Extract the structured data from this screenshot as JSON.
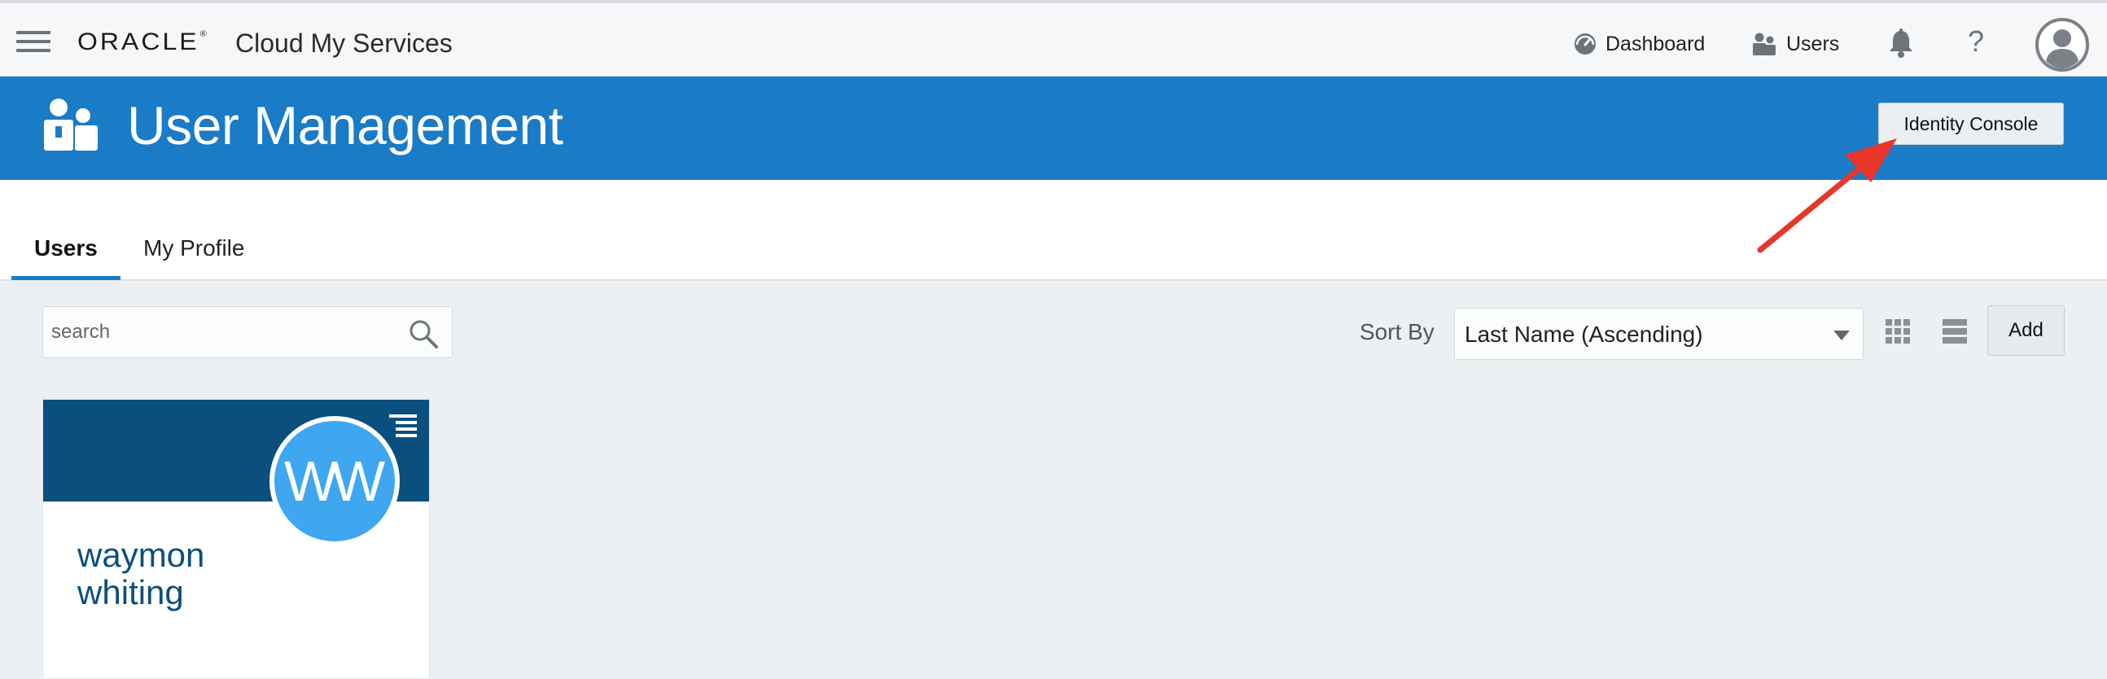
{
  "topbar": {
    "brand": "ORACLE",
    "brand_mark": "®",
    "app_name": "Cloud My Services",
    "nav": {
      "dashboard_label": "Dashboard",
      "users_label": "Users",
      "help_glyph": "?"
    },
    "icons": {
      "menu": "hamburger-menu-icon",
      "dashboard": "dashboard-gauge-icon",
      "users": "users-icon",
      "notifications": "bell-icon",
      "help": "help-icon",
      "profile": "user-avatar-icon"
    }
  },
  "banner": {
    "title": "User Management",
    "identity_console_label": "Identity Console",
    "icon": "users-icon",
    "background": "#1a7bc7"
  },
  "tabs": [
    {
      "label": "Users",
      "active": true
    },
    {
      "label": "My Profile",
      "active": false
    }
  ],
  "toolbar": {
    "search_placeholder": "search",
    "search_value": "",
    "sort_by_label": "Sort By",
    "sort_selected": "Last Name (Ascending)",
    "add_label": "Add",
    "view_icons": [
      "grid-view-icon",
      "list-view-icon"
    ]
  },
  "users": [
    {
      "initials": "WW",
      "first_name": "waymon",
      "last_name": "whiting",
      "header_color": "#0b4f7e",
      "avatar_color": "#3ea7ef"
    }
  ],
  "annotation": {
    "arrow_color": "#e8362a",
    "points_to": "identity-console-button"
  }
}
